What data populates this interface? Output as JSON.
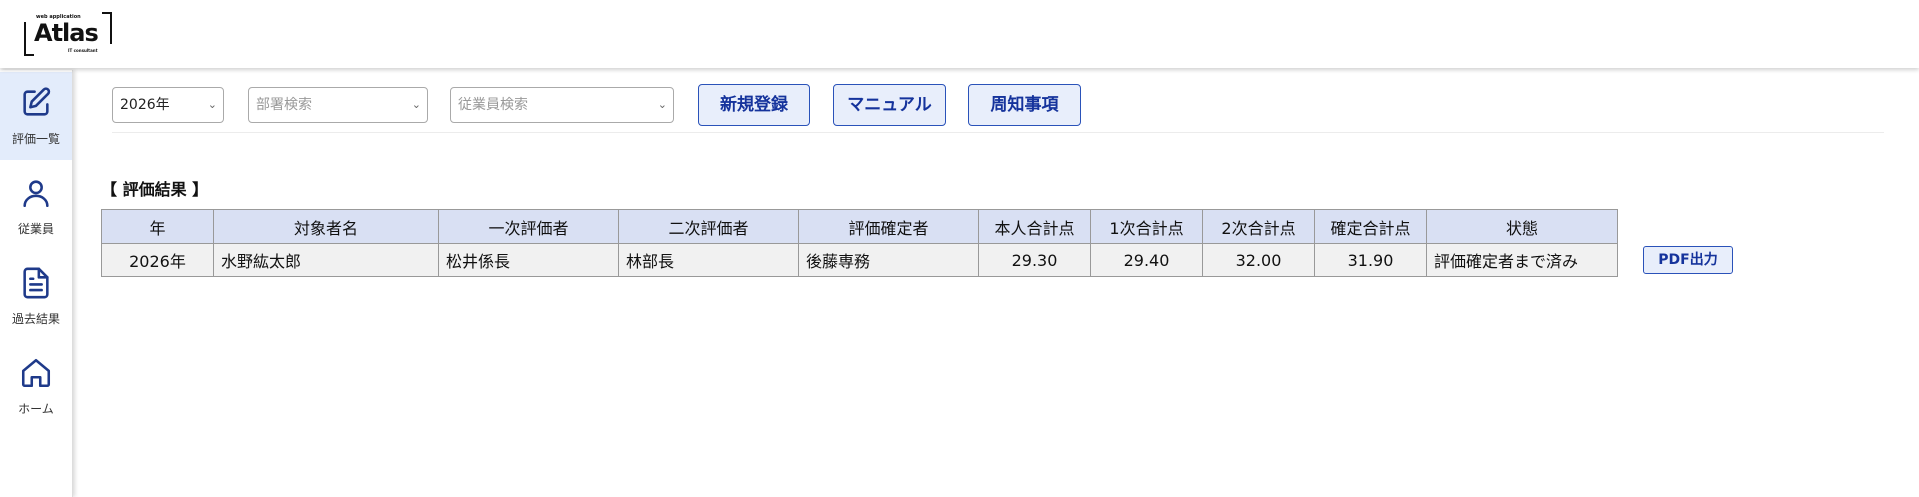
{
  "logo": {
    "top_text": "web application",
    "main_text": "Atlas",
    "bottom_text": "IT consultant"
  },
  "sidebar": {
    "items": [
      {
        "label": "評価一覧",
        "icon": "edit-icon",
        "active": true
      },
      {
        "label": "従業員",
        "icon": "user-icon",
        "active": false
      },
      {
        "label": "過去結果",
        "icon": "document-icon",
        "active": false
      },
      {
        "label": "ホーム",
        "icon": "home-icon",
        "active": false
      }
    ]
  },
  "filters": {
    "year": {
      "value": "2026年"
    },
    "department": {
      "placeholder": "部署検索"
    },
    "employee": {
      "placeholder": "従業員検索"
    }
  },
  "toolbar": {
    "new_label": "新規登録",
    "manual_label": "マニュアル",
    "notice_label": "周知事項"
  },
  "results": {
    "title": "【 評価結果 】",
    "columns": [
      "年",
      "対象者名",
      "一次評価者",
      "二次評価者",
      "評価確定者",
      "本人合計点",
      "1次合計点",
      "2次合計点",
      "確定合計点",
      "状態"
    ],
    "rows": [
      {
        "year": "2026年",
        "name": "水野紘太郎",
        "first_evaluator": "松井係長",
        "second_evaluator": "林部長",
        "confirmer": "後藤専務",
        "self_total": "29.30",
        "first_total": "29.40",
        "second_total": "32.00",
        "confirmed_total": "31.90",
        "status": "評価確定者まで済み",
        "pdf_label": "PDF出力"
      }
    ]
  },
  "colors": {
    "accent": "#15339c",
    "button_bg": "#e8eefb",
    "header_row_bg": "#d9e0f3",
    "active_sidebar_bg": "#e3ecfb"
  }
}
